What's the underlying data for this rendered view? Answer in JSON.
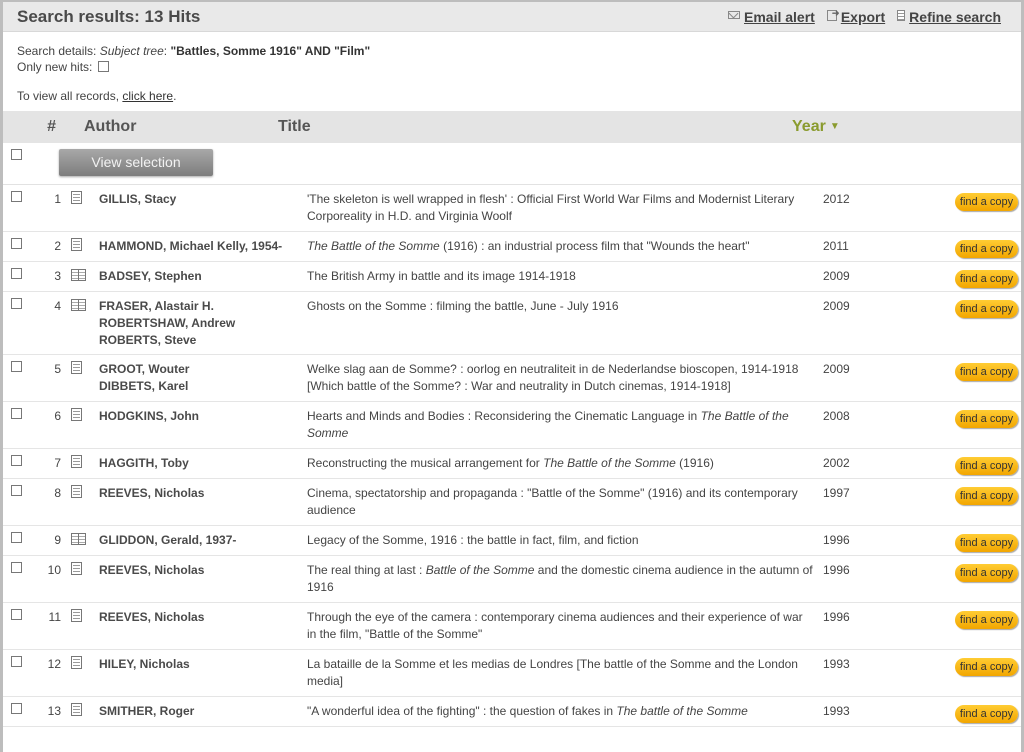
{
  "header": {
    "title": "Search results: 13 Hits",
    "email_alert": "Email alert",
    "export": "Export",
    "refine_search": "Refine search"
  },
  "details": {
    "label": "Search details:",
    "subject_label": "Subject tree",
    "query": "\"Battles, Somme 1916\" AND \"Film\"",
    "only_new_hits": "Only new hits:",
    "view_all_prefix": "To view all records,",
    "view_all_link": "click here",
    "view_all_suffix": "."
  },
  "columns": {
    "num": "#",
    "author": "Author",
    "title": "Title",
    "year": "Year"
  },
  "view_selection_label": "View selection",
  "find_copy_label": "find a copy",
  "results": [
    {
      "num": "1",
      "icon": "document-icon",
      "authors": [
        "GILLIS, Stacy"
      ],
      "title": [
        [
          "'The skeleton is well wrapped in flesh' : Official First World War Films and Modernist Literary Corporeality in H.D. and Virginia Woolf",
          false
        ]
      ],
      "year": "2012"
    },
    {
      "num": "2",
      "icon": "document-icon",
      "authors": [
        "HAMMOND, Michael Kelly, 1954-"
      ],
      "title": [
        [
          "The Battle of the Somme",
          true
        ],
        [
          " (1916) : an industrial process film that \"Wounds the heart\"",
          false
        ]
      ],
      "year": "2011"
    },
    {
      "num": "3",
      "icon": "book-icon",
      "authors": [
        "BADSEY, Stephen"
      ],
      "title": [
        [
          "The British Army in battle and its image 1914-1918",
          false
        ]
      ],
      "year": "2009"
    },
    {
      "num": "4",
      "icon": "book-icon",
      "authors": [
        "FRASER, Alastair H.",
        "ROBERTSHAW, Andrew",
        "ROBERTS, Steve"
      ],
      "title": [
        [
          "Ghosts on the Somme : filming the battle, June - July 1916",
          false
        ]
      ],
      "year": "2009"
    },
    {
      "num": "5",
      "icon": "document-icon",
      "authors": [
        "GROOT, Wouter",
        "DIBBETS, Karel"
      ],
      "title": [
        [
          "Welke slag aan de Somme? : oorlog en neutraliteit in de Nederlandse bioscopen, 1914-1918 [Which battle of the Somme? : War and neutrality in Dutch cinemas, 1914-1918]",
          false
        ]
      ],
      "year": "2009"
    },
    {
      "num": "6",
      "icon": "document-icon",
      "authors": [
        "HODGKINS, John"
      ],
      "title": [
        [
          "Hearts and Minds and Bodies : Reconsidering the Cinematic Language in ",
          false
        ],
        [
          "The Battle of the Somme",
          true
        ]
      ],
      "year": "2008"
    },
    {
      "num": "7",
      "icon": "document-icon",
      "authors": [
        "HAGGITH, Toby"
      ],
      "title": [
        [
          "Reconstructing the musical arrangement for ",
          false
        ],
        [
          "The Battle of the Somme",
          true
        ],
        [
          " (1916)",
          false
        ]
      ],
      "year": "2002"
    },
    {
      "num": "8",
      "icon": "document-icon",
      "authors": [
        "REEVES, Nicholas"
      ],
      "title": [
        [
          "Cinema, spectatorship and propaganda : \"Battle of the Somme\" (1916) and its contemporary audience",
          false
        ]
      ],
      "year": "1997"
    },
    {
      "num": "9",
      "icon": "book-icon",
      "authors": [
        "GLIDDON, Gerald, 1937-"
      ],
      "title": [
        [
          "Legacy of the Somme, 1916 : the battle in fact, film, and fiction",
          false
        ]
      ],
      "year": "1996"
    },
    {
      "num": "10",
      "icon": "document-icon",
      "authors": [
        "REEVES, Nicholas"
      ],
      "title": [
        [
          "The real thing at last : ",
          false
        ],
        [
          "Battle of the Somme",
          true
        ],
        [
          " and the domestic cinema audience in the autumn of 1916",
          false
        ]
      ],
      "year": "1996"
    },
    {
      "num": "11",
      "icon": "document-icon",
      "authors": [
        "REEVES, Nicholas"
      ],
      "title": [
        [
          "Through the eye of the camera : contemporary cinema audiences and their experience of war in the film, \"Battle of the Somme\"",
          false
        ]
      ],
      "year": "1996"
    },
    {
      "num": "12",
      "icon": "document-icon",
      "authors": [
        "HILEY, Nicholas"
      ],
      "title": [
        [
          "La bataille de la Somme et les medias de Londres [The battle of the Somme and the London media]",
          false
        ]
      ],
      "year": "1993"
    },
    {
      "num": "13",
      "icon": "document-icon",
      "authors": [
        "SMITHER, Roger"
      ],
      "title": [
        [
          "\"A wonderful idea of the fighting\" : the question of fakes in ",
          false
        ],
        [
          "The battle of the Somme",
          true
        ]
      ],
      "year": "1993"
    }
  ]
}
